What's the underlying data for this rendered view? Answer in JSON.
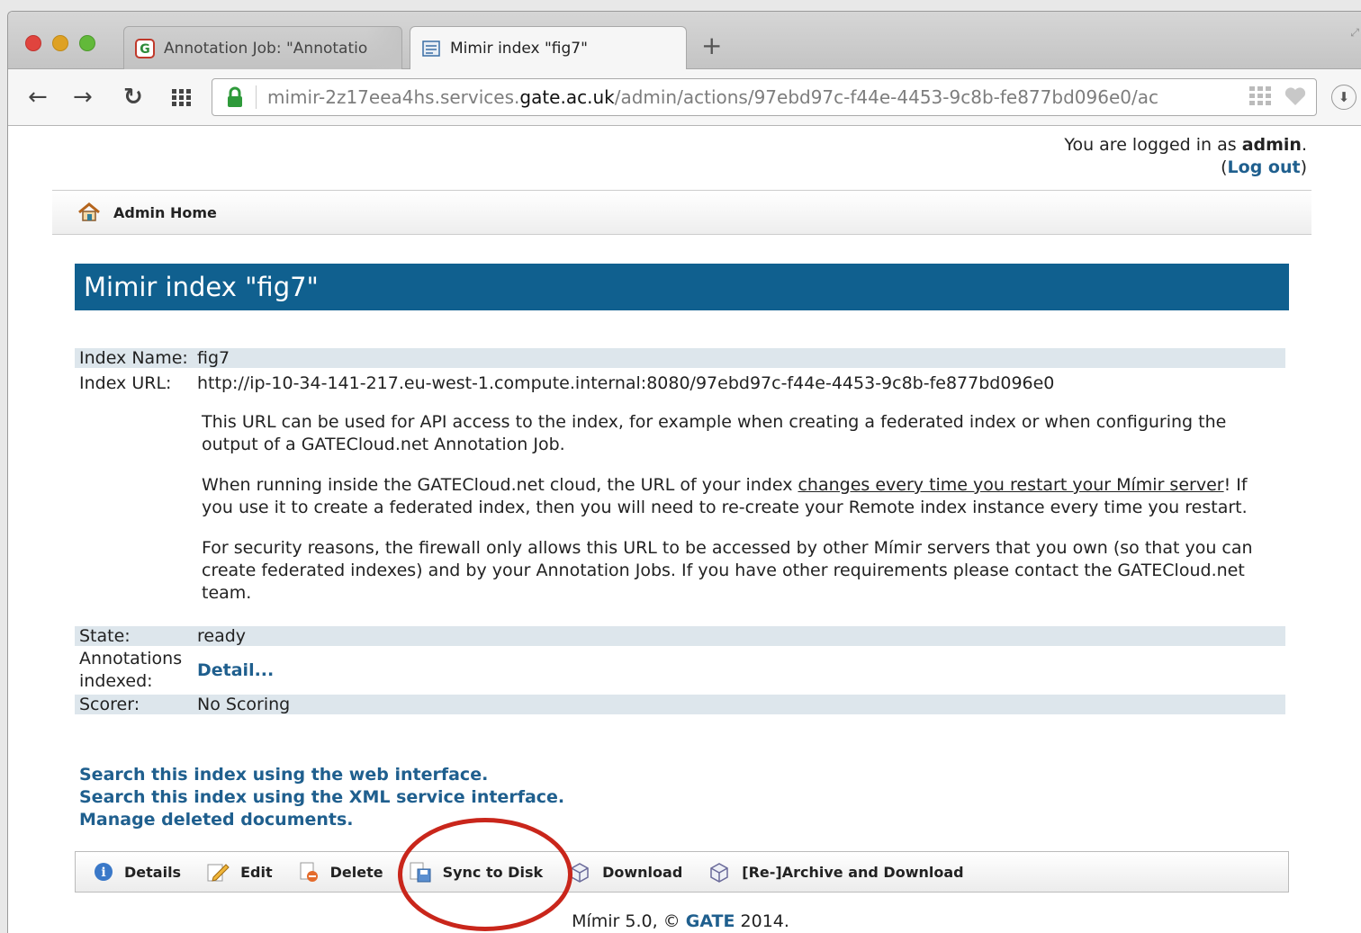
{
  "browser": {
    "tabs": [
      {
        "label": "Annotation Job: \"Annotatio",
        "active": false
      },
      {
        "label": "Mimir index \"fig7\"",
        "active": true
      }
    ],
    "new_tab": "+",
    "url": {
      "host_sub": "mimir-2z17eea4hs.services.",
      "host_main": "gate.ac.uk",
      "path": "/admin/actions/97ebd97c-f44e-4453-9c8b-fe877bd096e0/ac"
    }
  },
  "login": {
    "prefix": "You are logged in as ",
    "user": "admin",
    "suffix": ".",
    "open": "(",
    "logout": "Log out",
    "close": ")"
  },
  "adminbar": {
    "label": "Admin Home"
  },
  "title": "Mimir index \"fig7\"",
  "info": {
    "name_label": "Index Name:",
    "name_value": "fig7",
    "url_label": "Index URL:",
    "url_value": "http://ip-10-34-141-217.eu-west-1.compute.internal:8080/97ebd97c-f44e-4453-9c8b-fe877bd096e0",
    "para1": "This URL can be used for API access to the index, for example when creating a federated index or when configuring the output of a GATECloud.net Annotation Job.",
    "para2_before": "When running inside the GATECloud.net cloud, the URL of your index ",
    "para2_underline": "changes every time you restart your Mímir server",
    "para2_after": "! If you use it to create a federated index, then you will need to re-create your Remote index instance every time you restart.",
    "para3": "For security reasons, the firewall only allows this URL to be accessed by other Mímir servers that you own (so that you can create federated indexes) and by your Annotation Jobs. If you have other requirements please contact the GATECloud.net team.",
    "state_label": "State:",
    "state_value": "ready",
    "annotations_label": "Annotations indexed:",
    "annotations_link": "Detail...",
    "scorer_label": "Scorer:",
    "scorer_value": "No Scoring"
  },
  "links": [
    "Search this index using the web interface.",
    "Search this index using the XML service interface.",
    "Manage deleted documents."
  ],
  "actions": [
    "Details",
    "Edit",
    "Delete",
    "Sync to Disk",
    "Download",
    "[Re-]Archive and Download"
  ],
  "footer": {
    "prefix": "Mímir 5.0, © ",
    "link": "GATE",
    "suffix": " 2014."
  },
  "colors": {
    "title_bar": "#10608f",
    "link": "#1f5f8e",
    "highlight": "#c9261b"
  }
}
